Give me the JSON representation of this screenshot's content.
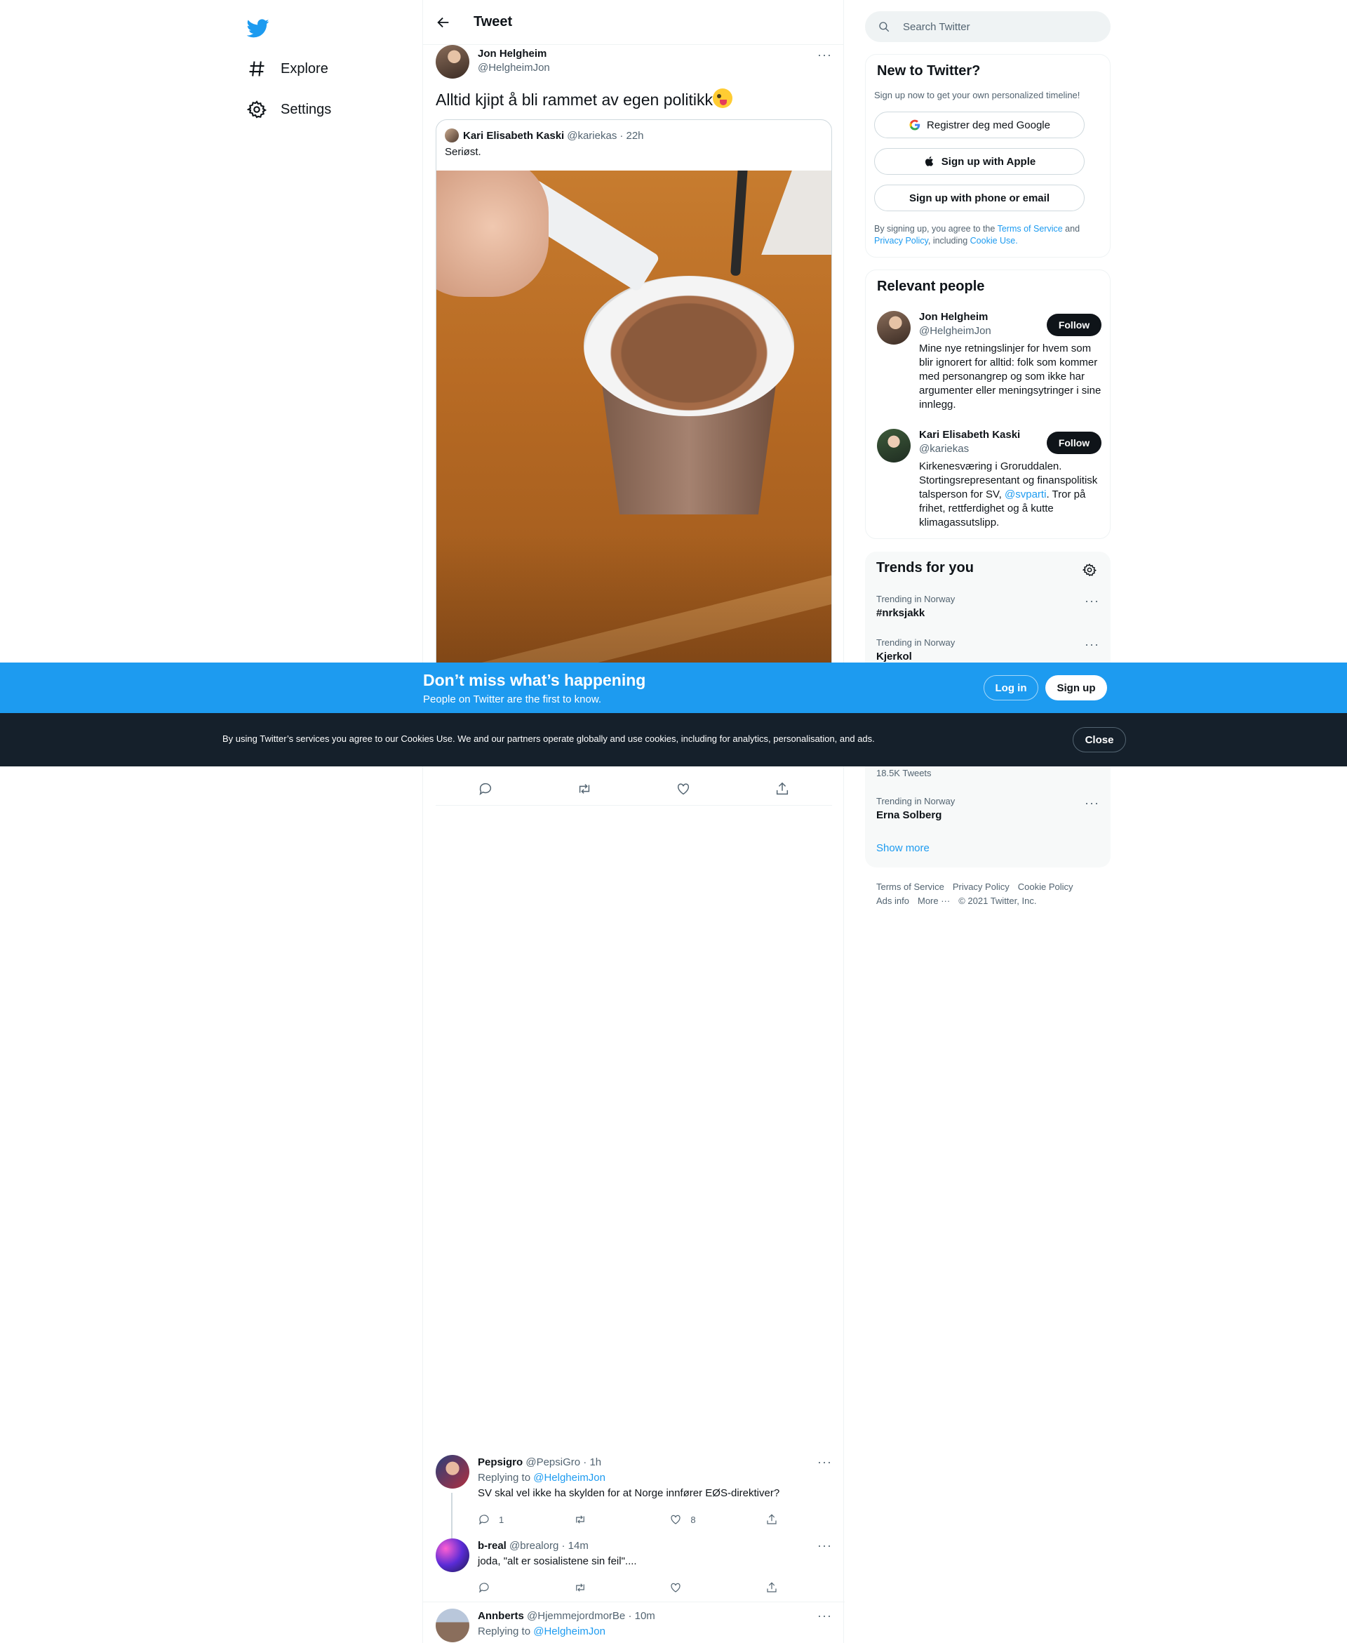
{
  "nav": {
    "explore": "Explore",
    "settings": "Settings"
  },
  "header": {
    "title": "Tweet"
  },
  "tweet": {
    "author_name": "Jon Helgheim",
    "author_handle": "@HelgheimJon",
    "text": "Alltid kjipt å bli rammet av egen politikk",
    "quote": {
      "author_name": "Kari Elisabeth Kaski",
      "author_handle": "@kariekas",
      "time": "· 22h",
      "text": "Seriøst."
    }
  },
  "replies": [
    {
      "name": "Pepsigro",
      "handle": "@PepsiGro",
      "time": "· 1h",
      "replying_label": "Replying to",
      "replying_to": "@HelgheimJon",
      "text": "SV skal vel ikke ha skylden for at Norge innfører EØS-direktiver?",
      "reply_count": "1",
      "like_count": "8"
    },
    {
      "name": "b-real",
      "handle": "@brealorg",
      "time": "· 14m",
      "text": "joda, \"alt er sosialistene sin feil\"...."
    },
    {
      "name": "Annberts",
      "handle": "@HjemmejordmorBe",
      "time": "· 10m",
      "replying_label": "Replying to",
      "replying_to": "@HelgheimJon"
    }
  ],
  "search": {
    "placeholder": "Search Twitter"
  },
  "signup_card": {
    "title": "New to Twitter?",
    "subtitle": "Sign up now to get your own personalized timeline!",
    "google": "Registrer deg med Google",
    "apple": "Sign up with Apple",
    "phone": "Sign up with phone or email",
    "legal_1": "By signing up, you agree to the ",
    "terms": "Terms of Service",
    "legal_2": " and ",
    "privacy": "Privacy Policy",
    "legal_3": ", including ",
    "cookie": "Cookie Use."
  },
  "people": {
    "title": "Relevant people",
    "follow_label": "Follow",
    "list": [
      {
        "name": "Jon Helgheim",
        "handle": "@HelgheimJon",
        "bio": "Mine nye retningslinjer for hvem som blir ignorert for alltid: folk som kommer med personangrep og som ikke har argumenter eller meningsytringer i sine innlegg."
      },
      {
        "name": "Kari Elisabeth Kaski",
        "handle": "@kariekas",
        "bio_1": "Kirkenesværing i Groruddalen. Stortingsrepresentant og finanspolitisk talsperson for SV, ",
        "bio_link": "@svparti",
        "bio_2": ". Tror på frihet, rettferdighet og å kutte klimagassutslipp."
      }
    ]
  },
  "trends": {
    "title": "Trends for you",
    "items": [
      {
        "context": "Trending in Norway",
        "name": "#nrksjakk"
      },
      {
        "context": "Trending in Norway",
        "name": "Kjerkol"
      },
      {
        "count": "18.5K Tweets"
      },
      {
        "context": "Trending in Norway",
        "name": "Erna Solberg"
      }
    ],
    "show_more": "Show more"
  },
  "footer": {
    "terms": "Terms of Service",
    "privacy": "Privacy Policy",
    "cookie": "Cookie Policy",
    "ads": "Ads info",
    "more": "More ···",
    "copyright": "© 2021 Twitter, Inc."
  },
  "banner": {
    "title": "Don’t miss what’s happening",
    "subtitle": "People on Twitter are the first to know.",
    "login": "Log in",
    "signup": "Sign up"
  },
  "cookies": {
    "text": "By using Twitter’s services you agree to our Cookies Use. We and our partners operate globally and use cookies, including for analytics, personalisation, and ads.",
    "close": "Close"
  },
  "colors": {
    "accent": "#1d9bf0",
    "dark": "#0f1419",
    "muted": "#536471",
    "cookie_bg": "#15202b"
  }
}
